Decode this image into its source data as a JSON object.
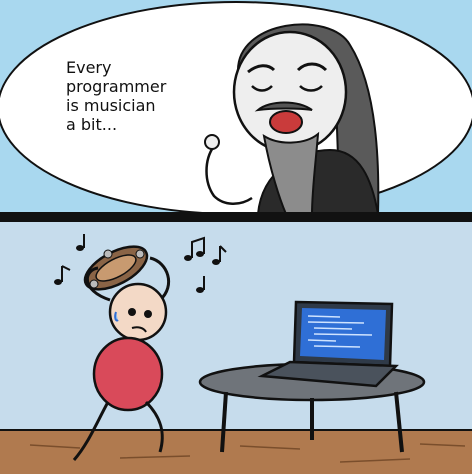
{
  "meme": {
    "caption_lines": [
      "Every",
      "programmer",
      "is musician",
      "a bit..."
    ]
  },
  "colors": {
    "sky_blue": "#a9d8ef",
    "bubble_white": "#ffffff",
    "panel_divider": "#111111",
    "wall_blue": "#c6dcec",
    "floor_brown": "#b07a4f",
    "robe_black": "#2a2a2a",
    "shirt_red": "#d94a5a",
    "screen_blue": "#2f6fd6",
    "table_grey": "#6f747a"
  }
}
